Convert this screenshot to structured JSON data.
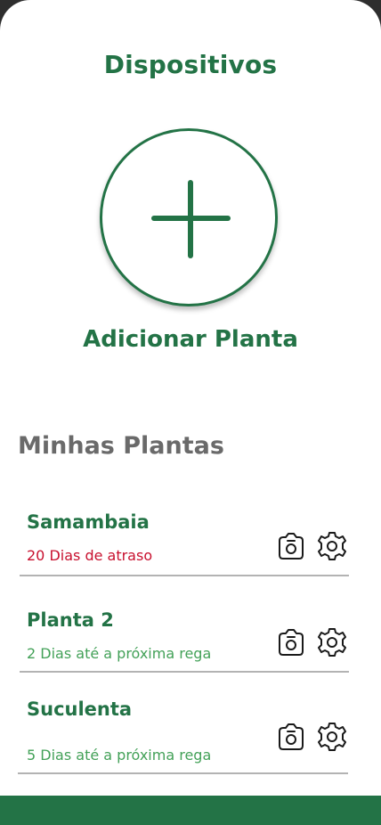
{
  "header": {
    "title": "Dispositivos"
  },
  "add_plant": {
    "label": "Adicionar Planta",
    "icon": "plus-icon"
  },
  "plants_section": {
    "title": "Minhas Plantas",
    "items": [
      {
        "name": "Samambaia",
        "status": "20 Dias de atraso",
        "status_type": "late"
      },
      {
        "name": "Planta 2",
        "status": "2 Dias até a próxima rega",
        "status_type": "ok"
      },
      {
        "name": "Suculenta",
        "status": "5 Dias até a próxima rega",
        "status_type": "ok"
      }
    ],
    "item_icons": [
      "camera-icon",
      "gear-icon"
    ]
  },
  "colors": {
    "accent": "#237346",
    "late": "#c8102e",
    "ok": "#43a158",
    "section_title": "#6a6a6a"
  }
}
